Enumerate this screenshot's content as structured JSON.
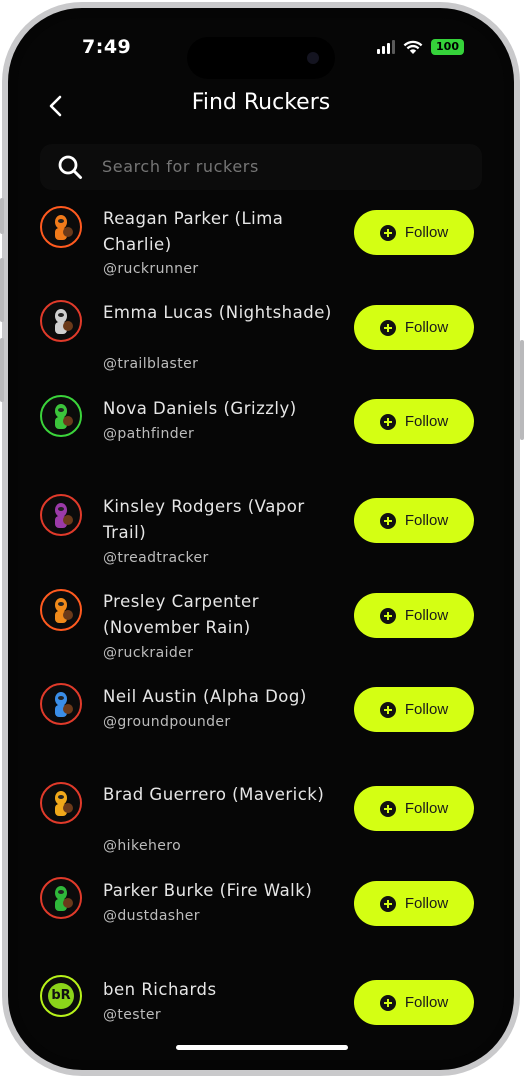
{
  "status_bar": {
    "time": "7:49",
    "battery": "100"
  },
  "header": {
    "title": "Find Ruckers",
    "back_icon": "chevron-left-icon"
  },
  "search": {
    "placeholder": "Search for ruckers",
    "icon": "search-icon"
  },
  "users": [
    {
      "name": "Reagan Parker (Lima Charlie)",
      "handle": "@ruckrunner",
      "follow_label": "Follow",
      "avatar_ring": "#ff5a1f",
      "avatar_color": "#f07a1a"
    },
    {
      "name": "Emma Lucas (Nightshade)",
      "handle": "@trailblaster",
      "follow_label": "Follow",
      "avatar_ring": "#e03a2a",
      "avatar_color": "#cfcfcf"
    },
    {
      "name": "Nova Daniels (Grizzly)",
      "handle": "@pathfinder",
      "follow_label": "Follow",
      "avatar_ring": "#3bd43b",
      "avatar_color": "#3bc43b"
    },
    {
      "name": "Kinsley Rodgers (Vapor Trail)",
      "handle": "@treadtracker",
      "follow_label": "Follow",
      "avatar_ring": "#e03a2a",
      "avatar_color": "#9b3aa8"
    },
    {
      "name": "Presley Carpenter (November Rain)",
      "handle": "@ruckraider",
      "follow_label": "Follow",
      "avatar_ring": "#ff5a1f",
      "avatar_color": "#f08a1a"
    },
    {
      "name": "Neil Austin (Alpha Dog)",
      "handle": "@groundpounder",
      "follow_label": "Follow",
      "avatar_ring": "#e03a2a",
      "avatar_color": "#3a8ee8"
    },
    {
      "name": "Brad Guerrero (Maverick)",
      "handle": "@hikehero",
      "follow_label": "Follow",
      "avatar_ring": "#e03a2a",
      "avatar_color": "#f0a81a"
    },
    {
      "name": "Parker Burke (Fire Walk)",
      "handle": "@dustdasher",
      "follow_label": "Follow",
      "avatar_ring": "#e03a2a",
      "avatar_color": "#2fb83a"
    },
    {
      "name": "ben Richards",
      "handle": "@tester",
      "follow_label": "Follow",
      "avatar_ring": "#b7f21a",
      "avatar_color": "#8bd41a",
      "avatar_text": "bR"
    }
  ]
}
